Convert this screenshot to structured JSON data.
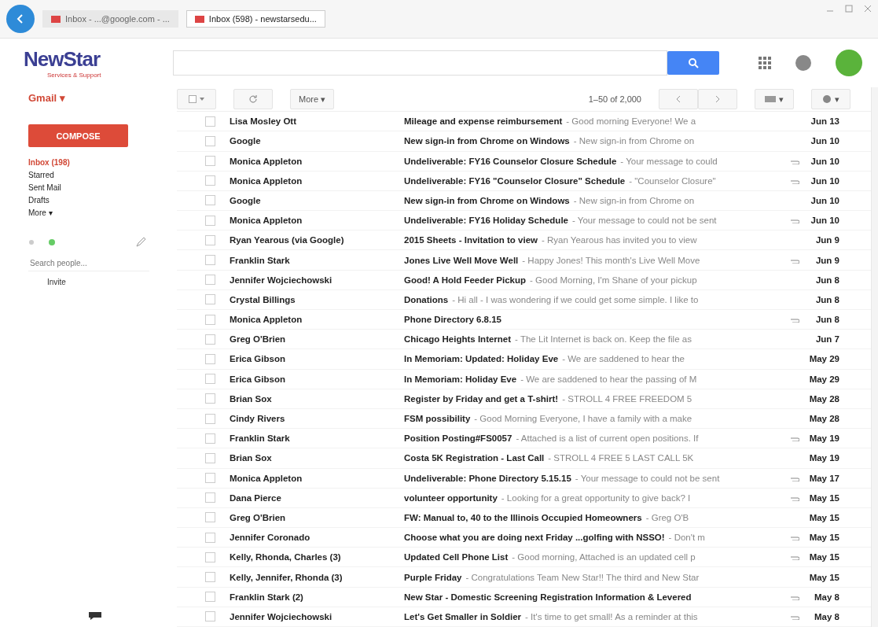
{
  "browser": {
    "tabs": [
      {
        "label": "Inbox - ...@google.com - ...",
        "selected": false
      },
      {
        "label": "Inbox (598) - newstarsedu...",
        "selected": true
      }
    ]
  },
  "header": {
    "logo": "NewStar",
    "tagline": "Services & Support"
  },
  "app_menu": "Gmail ▾",
  "toolbar": {
    "more": "More ▾",
    "range": "1–50 of 2,000",
    "input_tools": "▾",
    "settings": "▾"
  },
  "sidebar": {
    "compose": "COMPOSE",
    "items": [
      {
        "label": "Inbox (198)",
        "selected": true
      },
      {
        "label": "Starred",
        "selected": false
      },
      {
        "label": "Sent Mail",
        "selected": false
      },
      {
        "label": "Drafts",
        "selected": false
      },
      {
        "label": "More ▾",
        "selected": false
      }
    ],
    "people_search": {
      "placeholder": "Search people..."
    },
    "invite": "Invite"
  },
  "messages": [
    {
      "checked": false,
      "sender": "Lisa Mosley Ott",
      "subject": "Mileage and expense reimbursement",
      "snippet": "- Good morning Everyone! We a",
      "attachment": false,
      "date": "Jun 13"
    },
    {
      "checked": false,
      "sender": "Google",
      "subject": "New sign-in from Chrome on Windows",
      "snippet": "- New sign-in from Chrome on",
      "attachment": false,
      "date": "Jun 10"
    },
    {
      "checked": false,
      "sender": "Monica Appleton",
      "subject": "Undeliverable: FY16 Counselor Closure Schedule",
      "snippet": "- Your message to could",
      "attachment": true,
      "date": "Jun 10"
    },
    {
      "checked": false,
      "sender": "Monica Appleton",
      "subject": "Undeliverable: FY16 \"Counselor Closure\" Schedule",
      "snippet": "- \"Counselor Closure\"",
      "attachment": true,
      "date": "Jun 10"
    },
    {
      "checked": false,
      "sender": "Google",
      "subject": "New sign-in from Chrome on Windows",
      "snippet": "- New sign-in from Chrome on",
      "attachment": false,
      "date": "Jun 10"
    },
    {
      "checked": false,
      "sender": "Monica Appleton",
      "subject": "Undeliverable: FY16 Holiday Schedule",
      "snippet": "- Your message to could not be sent",
      "attachment": true,
      "date": "Jun 10"
    },
    {
      "checked": false,
      "sender": "Ryan Yearous (via Google)",
      "subject": "2015 Sheets - Invitation to view",
      "snippet": "- Ryan Yearous has invited you to view",
      "attachment": false,
      "date": "Jun 9"
    },
    {
      "checked": false,
      "sender": "Franklin Stark",
      "subject": "Jones Live Well Move Well",
      "snippet": "- Happy Jones! This month's Live Well Move",
      "attachment": true,
      "date": "Jun 9"
    },
    {
      "checked": false,
      "sender": "Jennifer Wojciechowski",
      "subject": "Good! A Hold Feeder Pickup",
      "snippet": "- Good Morning, I'm Shane of your pickup",
      "attachment": false,
      "date": "Jun 8"
    },
    {
      "checked": false,
      "sender": "Crystal Billings",
      "subject": "Donations",
      "snippet": "- Hi all - I was wondering if we could get some simple. I like to",
      "attachment": false,
      "date": "Jun 8"
    },
    {
      "checked": false,
      "sender": "Monica Appleton",
      "subject": "Phone Directory 6.8.15",
      "attachment": true,
      "date": "Jun 8"
    },
    {
      "checked": false,
      "sender": "Greg O'Brien",
      "subject": "Chicago Heights Internet",
      "snippet": "- The Lit Internet is back on. Keep the file as",
      "attachment": false,
      "date": "Jun 7"
    },
    {
      "checked": false,
      "sender": "Erica Gibson",
      "subject": "In Memoriam: Updated: Holiday Eve",
      "snippet": "- We are saddened to hear the",
      "attachment": false,
      "date": "May 29"
    },
    {
      "checked": false,
      "sender": "Erica Gibson",
      "subject": "In Memoriam: Holiday Eve",
      "snippet": "- We are saddened to hear the passing of M",
      "attachment": false,
      "date": "May 29"
    },
    {
      "checked": false,
      "sender": "Brian Sox",
      "subject": "Register by Friday and get a T-shirt!",
      "snippet": "- STROLL 4 FREE FREEDOM 5",
      "attachment": false,
      "date": "May 28"
    },
    {
      "checked": false,
      "sender": "Cindy Rivers",
      "subject": "FSM possibility",
      "snippet": "- Good Morning Everyone, I have a family with a make",
      "attachment": false,
      "date": "May 28"
    },
    {
      "checked": false,
      "sender": "Franklin Stark",
      "subject": "Position Posting#FS0057",
      "snippet": "- Attached is a list of current open positions. If",
      "attachment": true,
      "date": "May 19"
    },
    {
      "checked": false,
      "sender": "Brian Sox",
      "subject": "Costa 5K Registration - Last Call",
      "snippet": "- STROLL 4 FREE 5 LAST CALL 5K",
      "attachment": false,
      "date": "May 19"
    },
    {
      "checked": false,
      "sender": "Monica Appleton",
      "subject": "Undeliverable: Phone Directory 5.15.15",
      "snippet": "- Your message to could not be sent",
      "attachment": true,
      "date": "May 17"
    },
    {
      "checked": false,
      "sender": "Dana Pierce",
      "subject": "volunteer opportunity",
      "snippet": "- Looking for a great opportunity to give back? I",
      "attachment": true,
      "date": "May 15"
    },
    {
      "checked": false,
      "sender": "Greg O'Brien",
      "subject": "FW: Manual to, 40 to the Illinois Occupied Homeowners",
      "snippet": "- Greg O'B",
      "attachment": false,
      "date": "May 15"
    },
    {
      "checked": false,
      "sender": "Jennifer Coronado",
      "subject": "Choose what you are doing next Friday ...golfing with NSSO!",
      "snippet": "- Don't m",
      "attachment": true,
      "date": "May 15"
    },
    {
      "checked": false,
      "sender": "Kelly, Rhonda, Charles (3)",
      "subject": "Updated Cell Phone List",
      "snippet": "- Good morning, Attached is an updated cell p",
      "attachment": true,
      "date": "May 15"
    },
    {
      "checked": false,
      "sender": "Kelly, Jennifer, Rhonda (3)",
      "subject": "Purple Friday",
      "snippet": "- Congratulations Team New Star!! The third and New Star",
      "attachment": false,
      "date": "May 15"
    },
    {
      "checked": false,
      "sender": "Franklin Stark (2)",
      "subject": "New Star - Domestic Screening Registration Information & Levered",
      "attachment": true,
      "date": "May 8"
    },
    {
      "checked": false,
      "sender": "Jennifer Wojciechowski",
      "subject": "Let's Get Smaller in Soldier",
      "snippet": "- It's time to get small! As a reminder at this",
      "attachment": true,
      "date": "May 8"
    }
  ]
}
